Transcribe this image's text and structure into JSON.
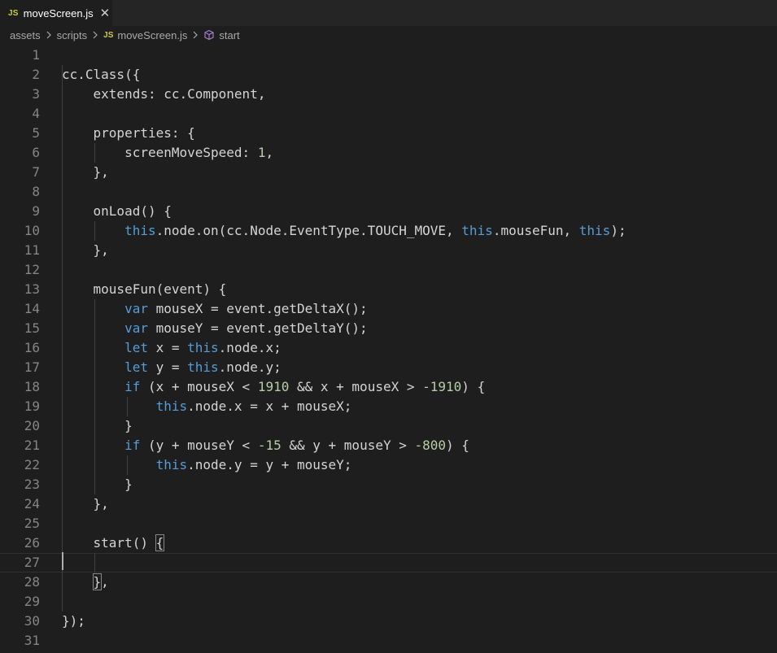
{
  "tab": {
    "badge": "JS",
    "title": "moveScreen.js",
    "close_glyph": "✕"
  },
  "breadcrumb": {
    "items": [
      "assets",
      "scripts",
      "moveScreen.js",
      "start"
    ],
    "file_badge": "JS",
    "symbol_icon": "cube-icon"
  },
  "colors": {
    "background": "#1e1e1e",
    "keyword": "#569cd6",
    "number": "#b5cea8",
    "text": "#d4d4d4",
    "line_number": "#858585",
    "js_badge": "#cbcb41"
  },
  "editor": {
    "current_line": 27,
    "lines": [
      [],
      [
        {
          "t": "cc.Class({"
        }
      ],
      [
        {
          "t": "    extends: cc.Component,"
        }
      ],
      [],
      [
        {
          "t": "    properties: {"
        }
      ],
      [
        {
          "t": "        screenMoveSpeed: "
        },
        {
          "t": "1",
          "c": "num"
        },
        {
          "t": ","
        }
      ],
      [
        {
          "t": "    },"
        }
      ],
      [],
      [
        {
          "t": "    onLoad() {"
        }
      ],
      [
        {
          "t": "        "
        },
        {
          "t": "this",
          "c": "kw"
        },
        {
          "t": ".node.on(cc.Node.EventType.TOUCH_MOVE, "
        },
        {
          "t": "this",
          "c": "kw"
        },
        {
          "t": ".mouseFun, "
        },
        {
          "t": "this",
          "c": "kw"
        },
        {
          "t": ");"
        }
      ],
      [
        {
          "t": "    },"
        }
      ],
      [],
      [
        {
          "t": "    mouseFun(event) {"
        }
      ],
      [
        {
          "t": "        "
        },
        {
          "t": "var",
          "c": "kw"
        },
        {
          "t": " mouseX = event.getDeltaX();"
        }
      ],
      [
        {
          "t": "        "
        },
        {
          "t": "var",
          "c": "kw"
        },
        {
          "t": " mouseY = event.getDeltaY();"
        }
      ],
      [
        {
          "t": "        "
        },
        {
          "t": "let",
          "c": "kw"
        },
        {
          "t": " x = "
        },
        {
          "t": "this",
          "c": "kw"
        },
        {
          "t": ".node.x;"
        }
      ],
      [
        {
          "t": "        "
        },
        {
          "t": "let",
          "c": "kw"
        },
        {
          "t": " y = "
        },
        {
          "t": "this",
          "c": "kw"
        },
        {
          "t": ".node.y;"
        }
      ],
      [
        {
          "t": "        "
        },
        {
          "t": "if",
          "c": "kw"
        },
        {
          "t": " (x + mouseX < "
        },
        {
          "t": "1910",
          "c": "num"
        },
        {
          "t": " && x + mouseX > "
        },
        {
          "t": "-1910",
          "c": "num"
        },
        {
          "t": ") {"
        }
      ],
      [
        {
          "t": "            "
        },
        {
          "t": "this",
          "c": "kw"
        },
        {
          "t": ".node.x = x + mouseX;"
        }
      ],
      [
        {
          "t": "        }"
        }
      ],
      [
        {
          "t": "        "
        },
        {
          "t": "if",
          "c": "kw"
        },
        {
          "t": " (y + mouseY < "
        },
        {
          "t": "-15",
          "c": "num"
        },
        {
          "t": " && y + mouseY > "
        },
        {
          "t": "-800",
          "c": "num"
        },
        {
          "t": ") {"
        }
      ],
      [
        {
          "t": "            "
        },
        {
          "t": "this",
          "c": "kw"
        },
        {
          "t": ".node.y = y + mouseY;"
        }
      ],
      [
        {
          "t": "        }"
        }
      ],
      [
        {
          "t": "    },"
        }
      ],
      [],
      [
        {
          "t": "    start() "
        },
        {
          "t": "{",
          "c": "bm"
        }
      ],
      [],
      [
        {
          "t": "    "
        },
        {
          "t": "}",
          "c": "bm"
        },
        {
          "t": ","
        }
      ],
      [],
      [
        {
          "t": "});"
        }
      ],
      []
    ]
  }
}
